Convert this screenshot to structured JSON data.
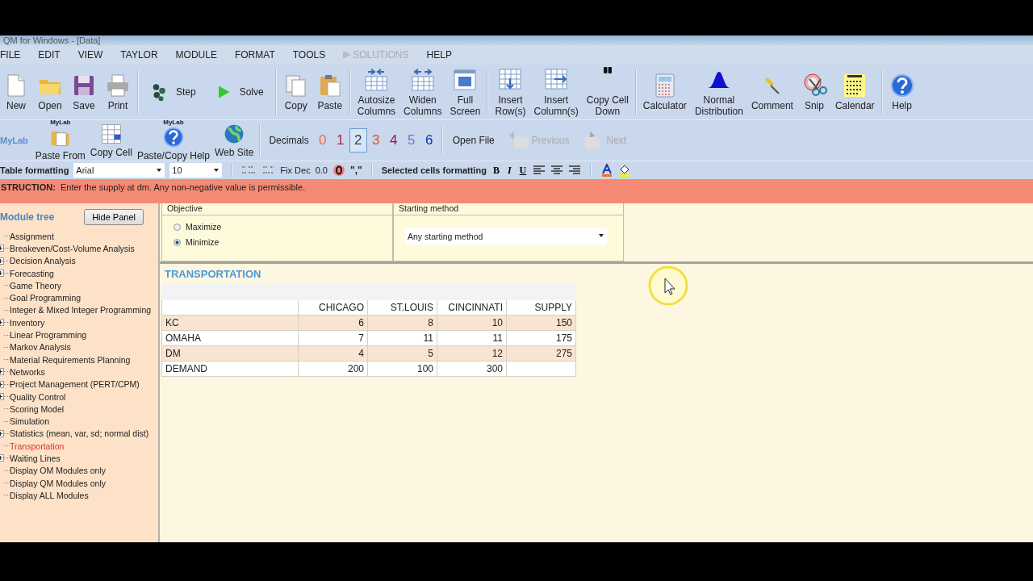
{
  "window": {
    "title": "QM for Windows - [Data]"
  },
  "menu": [
    {
      "label": "FILE",
      "disabled": false
    },
    {
      "label": "EDIT",
      "disabled": false
    },
    {
      "label": "VIEW",
      "disabled": false
    },
    {
      "label": "TAYLOR",
      "disabled": false
    },
    {
      "label": "MODULE",
      "disabled": false
    },
    {
      "label": "FORMAT",
      "disabled": false
    },
    {
      "label": "TOOLS",
      "disabled": false
    },
    {
      "label": "SOLUTIONS",
      "disabled": true
    },
    {
      "label": "HELP",
      "disabled": false
    }
  ],
  "toolbar": {
    "groups": [
      [
        {
          "kind": "stacked",
          "lines": [
            "New"
          ]
        },
        {
          "kind": "stacked",
          "lines": [
            "Open"
          ]
        },
        {
          "kind": "stacked",
          "lines": [
            "Save"
          ]
        },
        {
          "kind": "stacked",
          "lines": [
            "Print"
          ]
        }
      ],
      [
        {
          "kind": "inline",
          "lines": [
            "Step"
          ]
        },
        {
          "kind": "inline",
          "lines": [
            "Solve"
          ]
        }
      ],
      [
        {
          "kind": "stacked",
          "lines": [
            "Copy"
          ]
        },
        {
          "kind": "stacked",
          "lines": [
            "Paste"
          ]
        }
      ],
      [
        {
          "kind": "stacked",
          "lines": [
            "Autosize",
            "Columns"
          ]
        },
        {
          "kind": "stacked",
          "lines": [
            "Widen",
            "Columns"
          ]
        },
        {
          "kind": "stacked",
          "lines": [
            "Full",
            "Screen"
          ]
        }
      ],
      [
        {
          "kind": "stacked",
          "lines": [
            "Insert",
            "Row(s)"
          ]
        },
        {
          "kind": "stacked",
          "lines": [
            "Insert",
            "Column(s)"
          ]
        },
        {
          "kind": "stacked",
          "lines": [
            "Copy Cell",
            "Down"
          ]
        }
      ],
      [
        {
          "kind": "stacked",
          "lines": [
            "Calculator"
          ]
        },
        {
          "kind": "stacked",
          "lines": [
            "Normal",
            "Distribution"
          ]
        },
        {
          "kind": "stacked",
          "lines": [
            "Comment"
          ]
        },
        {
          "kind": "stacked",
          "lines": [
            "Snip"
          ]
        },
        {
          "kind": "stacked",
          "lines": [
            "Calendar"
          ]
        }
      ],
      [
        {
          "kind": "stacked",
          "lines": [
            "Help"
          ]
        }
      ]
    ]
  },
  "toolbar2": {
    "left_label": "MyLab",
    "items": [
      {
        "badge": "MyLab",
        "label": "Paste From"
      },
      {
        "label": "Copy Cell"
      },
      {
        "badge": "MyLab",
        "label": "Paste/Copy Help"
      },
      {
        "label": "Web Site"
      }
    ],
    "decimals_label": "Decimals",
    "decimals": [
      {
        "label": "0",
        "color": "#f06a4a",
        "selected": false
      },
      {
        "label": "1",
        "color": "#b3204c",
        "selected": false
      },
      {
        "label": "2",
        "color": "#303a66",
        "selected": true
      },
      {
        "label": "3",
        "color": "#e4502a",
        "selected": false
      },
      {
        "label": "4",
        "color": "#a0103e",
        "selected": false
      },
      {
        "label": "5",
        "color": "#7474d4",
        "selected": false
      },
      {
        "label": "6",
        "color": "#1030c0",
        "selected": false
      }
    ],
    "nav": [
      {
        "label": "Open File",
        "disabled": false
      },
      {
        "label": "Previous",
        "disabled": true
      },
      {
        "label": "Next",
        "disabled": true
      }
    ]
  },
  "format_bar": {
    "label": "Table formatting",
    "font": "Arial",
    "size": "10",
    "fix_dec": "Fix Dec",
    "fix_dec_value": "0.0",
    "separator": "\",\"",
    "selected_label": "Selected cells formatting",
    "style_buttons": [
      "B",
      "I",
      "U"
    ]
  },
  "instruction": {
    "prefix": "STRUCTION:",
    "text": "Enter the supply at dm. Any non-negative value is permissible."
  },
  "sidebar": {
    "title": "Module tree",
    "hide_button": "Hide Panel",
    "items": [
      {
        "label": "Assignment",
        "has_children": false,
        "selected": false
      },
      {
        "label": "Breakeven/Cost-Volume Analysis",
        "has_children": true,
        "selected": false
      },
      {
        "label": "Decision Analysis",
        "has_children": true,
        "selected": false
      },
      {
        "label": "Forecasting",
        "has_children": true,
        "selected": false
      },
      {
        "label": "Game Theory",
        "has_children": false,
        "selected": false
      },
      {
        "label": "Goal Programming",
        "has_children": false,
        "selected": false
      },
      {
        "label": "Integer & Mixed Integer Programming",
        "has_children": false,
        "selected": false
      },
      {
        "label": "Inventory",
        "has_children": true,
        "selected": false
      },
      {
        "label": "Linear Programming",
        "has_children": false,
        "selected": false
      },
      {
        "label": "Markov Analysis",
        "has_children": false,
        "selected": false
      },
      {
        "label": "Material Requirements Planning",
        "has_children": false,
        "selected": false
      },
      {
        "label": "Networks",
        "has_children": true,
        "selected": false
      },
      {
        "label": "Project Management (PERT/CPM)",
        "has_children": true,
        "selected": false
      },
      {
        "label": "Quality Control",
        "has_children": true,
        "selected": false
      },
      {
        "label": "Scoring Model",
        "has_children": false,
        "selected": false
      },
      {
        "label": "Simulation",
        "has_children": false,
        "selected": false
      },
      {
        "label": "Statistics (mean, var, sd; normal dist)",
        "has_children": true,
        "selected": false
      },
      {
        "label": "Transportation",
        "has_children": false,
        "selected": true
      },
      {
        "label": "Waiting Lines",
        "has_children": true,
        "selected": false
      },
      {
        "label": "Display OM Modules only",
        "has_children": false,
        "selected": false
      },
      {
        "label": "Display QM Modules only",
        "has_children": false,
        "selected": false
      },
      {
        "label": "Display ALL Modules",
        "has_children": false,
        "selected": false
      }
    ]
  },
  "objective": {
    "title": "Objective",
    "options": [
      {
        "label": "Maximize",
        "selected": false
      },
      {
        "label": "Minimize",
        "selected": true
      }
    ]
  },
  "starting_method": {
    "title": "Starting method",
    "value": "Any starting method"
  },
  "table": {
    "title": "TRANSPORTATION",
    "columns": [
      "CHICAGO",
      "ST.LOUIS",
      "CINCINNATI",
      "SUPPLY"
    ],
    "rows": [
      {
        "label": "KC",
        "cells": [
          "6",
          "8",
          "10",
          "150"
        ]
      },
      {
        "label": "OMAHA",
        "cells": [
          "7",
          "11",
          "11",
          "175"
        ]
      },
      {
        "label": "DM",
        "cells": [
          "4",
          "5",
          "12",
          "275"
        ]
      },
      {
        "label": "DEMAND",
        "cells": [
          "200",
          "100",
          "300"
        ]
      }
    ]
  }
}
